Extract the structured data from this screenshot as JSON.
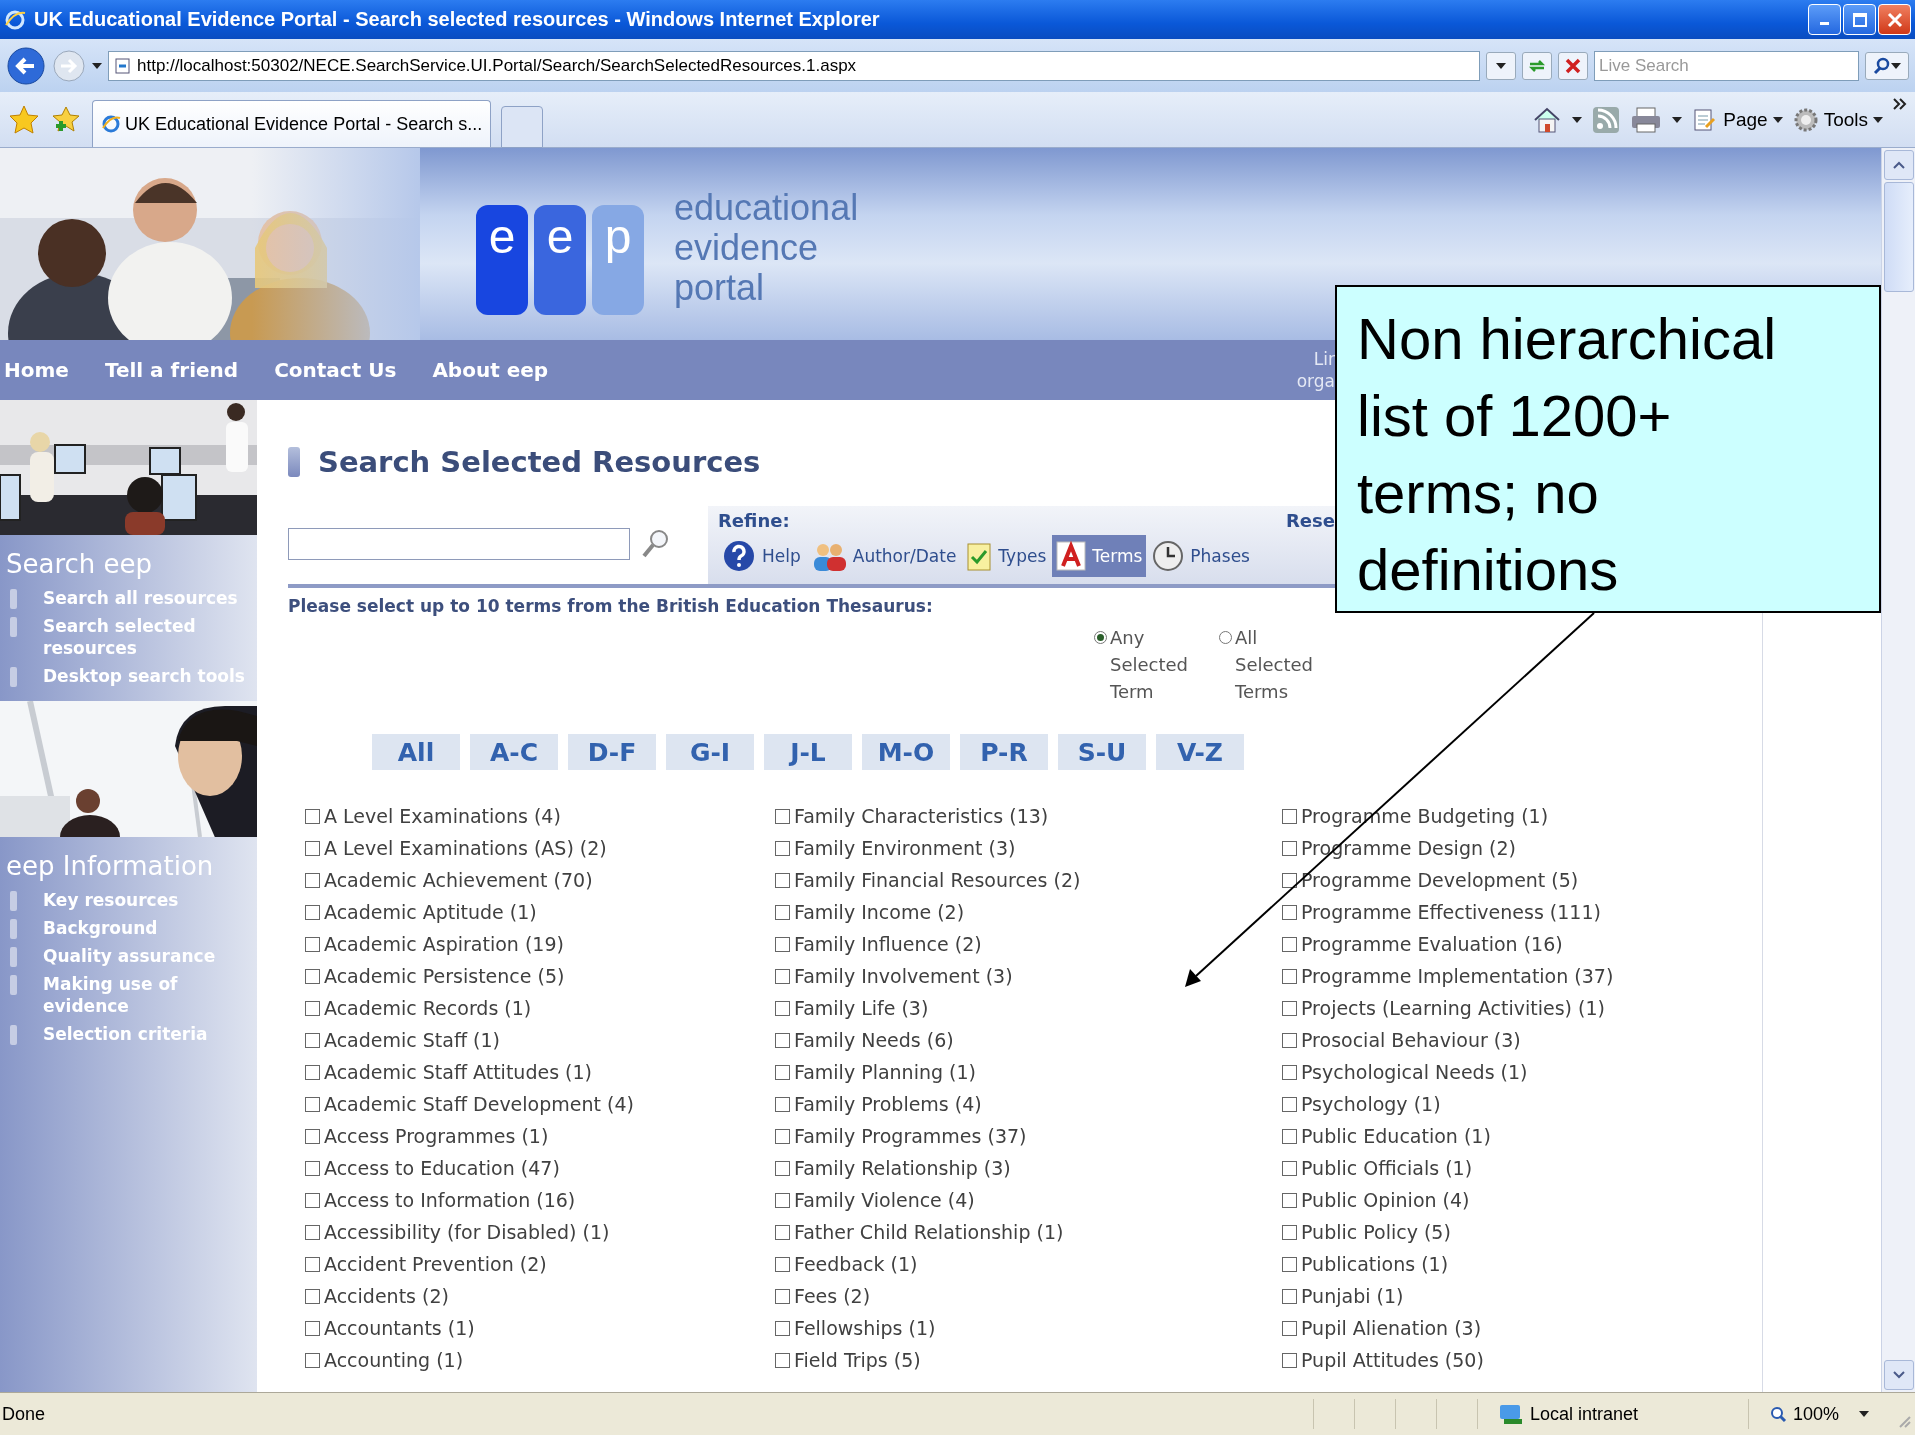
{
  "window": {
    "title": "UK Educational Evidence Portal - Search selected resources - Windows Internet Explorer"
  },
  "address_bar": {
    "url": "http://localhost:50302/NECE.SearchService.UI.Portal/Search/SearchSelectedResources.1.aspx"
  },
  "live_search": {
    "placeholder": "Live Search"
  },
  "browser_tabs": [
    {
      "label": "UK Educational Evidence Portal - Search s...",
      "selected": true
    }
  ],
  "command_bar": [
    "Page",
    "Tools"
  ],
  "site": {
    "logo_letters": [
      "e",
      "e",
      "p"
    ],
    "logo_words": [
      "educational",
      "evidence",
      "portal"
    ]
  },
  "nav": {
    "items": [
      "Home",
      "Tell a friend",
      "Contact Us",
      "About eep"
    ],
    "side_text": [
      "Lir",
      "orga"
    ]
  },
  "sidebar": {
    "sections": [
      {
        "title": "Search eep",
        "items": [
          "Search all resources",
          "Search selected resources",
          "Desktop search tools"
        ]
      },
      {
        "title": "eep Information",
        "items": [
          "Key resources",
          "Background",
          "Quality assurance",
          "Making use of evidence",
          "Selection criteria"
        ]
      }
    ]
  },
  "page": {
    "title": "Search Selected Resources"
  },
  "refine": {
    "label": "Refine:",
    "reset": "Rese",
    "tabs": [
      {
        "label": "Help",
        "kind": "help",
        "selected": false
      },
      {
        "label": "Author/Date",
        "kind": "author",
        "selected": false
      },
      {
        "label": "Types",
        "kind": "types",
        "selected": false
      },
      {
        "label": "Terms",
        "kind": "terms",
        "selected": true
      },
      {
        "label": "Phases",
        "kind": "phases",
        "selected": false
      }
    ]
  },
  "instruction": "Please select up to 10 terms from the British Education Thesaurus:",
  "match_options": [
    {
      "label": "Any Selected Term",
      "selected": true
    },
    {
      "label": "All Selected Terms",
      "selected": false
    }
  ],
  "letter_filters": [
    "All",
    "A-C",
    "D-F",
    "G-I",
    "J-L",
    "M-O",
    "P-R",
    "S-U",
    "V-Z"
  ],
  "terms": {
    "columns": [
      [
        {
          "label": "A Level Examinations (4)",
          "checked": false
        },
        {
          "label": "A Level Examinations (AS) (2)",
          "checked": false
        },
        {
          "label": "Academic Achievement (70)",
          "checked": false
        },
        {
          "label": "Academic Aptitude (1)",
          "checked": false
        },
        {
          "label": "Academic Aspiration (19)",
          "checked": false
        },
        {
          "label": "Academic Persistence (5)",
          "checked": false
        },
        {
          "label": "Academic Records (1)",
          "checked": false
        },
        {
          "label": "Academic Staff (1)",
          "checked": false
        },
        {
          "label": "Academic Staff Attitudes (1)",
          "checked": false
        },
        {
          "label": "Academic Staff Development (4)",
          "checked": false
        },
        {
          "label": "Access Programmes (1)",
          "checked": false
        },
        {
          "label": "Access to Education (47)",
          "checked": false
        },
        {
          "label": "Access to Information (16)",
          "checked": false
        },
        {
          "label": "Accessibility (for Disabled) (1)",
          "checked": false
        },
        {
          "label": "Accident Prevention (2)",
          "checked": false
        },
        {
          "label": "Accidents (2)",
          "checked": false
        },
        {
          "label": "Accountants (1)",
          "checked": false
        },
        {
          "label": "Accounting (1)",
          "checked": false
        }
      ],
      [
        {
          "label": "Family Characteristics (13)",
          "checked": false
        },
        {
          "label": "Family Environment (3)",
          "checked": false
        },
        {
          "label": "Family Financial Resources (2)",
          "checked": false
        },
        {
          "label": "Family Income (2)",
          "checked": false
        },
        {
          "label": "Family Influence (2)",
          "checked": false
        },
        {
          "label": "Family Involvement (3)",
          "checked": false
        },
        {
          "label": "Family Life (3)",
          "checked": false
        },
        {
          "label": "Family Needs (6)",
          "checked": false
        },
        {
          "label": "Family Planning (1)",
          "checked": false
        },
        {
          "label": "Family Problems (4)",
          "checked": false
        },
        {
          "label": "Family Programmes (37)",
          "checked": false
        },
        {
          "label": "Family Relationship (3)",
          "checked": false
        },
        {
          "label": "Family Violence (4)",
          "checked": false
        },
        {
          "label": "Father Child Relationship (1)",
          "checked": false
        },
        {
          "label": "Feedback (1)",
          "checked": false
        },
        {
          "label": "Fees (2)",
          "checked": false
        },
        {
          "label": "Fellowships (1)",
          "checked": false
        },
        {
          "label": "Field Trips (5)",
          "checked": false
        }
      ],
      [
        {
          "label": "Programme Budgeting (1)",
          "checked": false
        },
        {
          "label": "Programme Design (2)",
          "checked": false
        },
        {
          "label": "Programme Development (5)",
          "checked": false
        },
        {
          "label": "Programme Effectiveness (111)",
          "checked": false
        },
        {
          "label": "Programme Evaluation (16)",
          "checked": false
        },
        {
          "label": "Programme Implementation (37)",
          "checked": false
        },
        {
          "label": "Projects (Learning Activities) (1)",
          "checked": false
        },
        {
          "label": "Prosocial Behaviour (3)",
          "checked": false
        },
        {
          "label": "Psychological Needs (1)",
          "checked": false
        },
        {
          "label": "Psychology (1)",
          "checked": false
        },
        {
          "label": "Public Education (1)",
          "checked": false
        },
        {
          "label": "Public Officials (1)",
          "checked": false
        },
        {
          "label": "Public Opinion (4)",
          "checked": false
        },
        {
          "label": "Public Policy (5)",
          "checked": false
        },
        {
          "label": "Publications (1)",
          "checked": false
        },
        {
          "label": "Punjabi (1)",
          "checked": false
        },
        {
          "label": "Pupil Alienation (3)",
          "checked": false
        },
        {
          "label": "Pupil Attitudes (50)",
          "checked": false
        }
      ]
    ]
  },
  "status_bar": {
    "text": "Done",
    "zone": "Local intranet",
    "zoom": "100%"
  },
  "callout": {
    "text": "Non hierarchical list of 1200+ terms; no definitions"
  }
}
